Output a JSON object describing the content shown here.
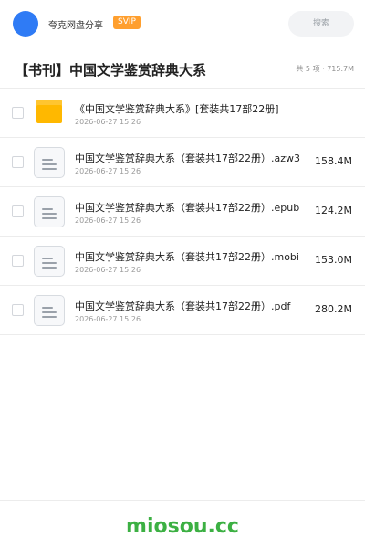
{
  "header": {
    "brand": "夸克网盘分享",
    "badge": "SVIP",
    "search_placeholder": "搜索",
    "accent_color": "#2f7bf5"
  },
  "share": {
    "title": "【书刊】中国文学鉴赏辞典大系",
    "meta": "共 5 项 · 715.7M"
  },
  "files": [
    {
      "icon": "folder-icon",
      "name": "《中国文学鉴赏辞典大系》[套装共17部22册]",
      "date": "2026-06-27 15:26",
      "size": ""
    },
    {
      "icon": "document-icon",
      "name": "中国文学鉴赏辞典大系（套装共17部22册）.azw3",
      "date": "2026-06-27 15:26",
      "size": "158.4M"
    },
    {
      "icon": "document-icon",
      "name": "中国文学鉴赏辞典大系（套装共17部22册）.epub",
      "date": "2026-06-27 15:26",
      "size": "124.2M"
    },
    {
      "icon": "document-icon",
      "name": "中国文学鉴赏辞典大系（套装共17部22册）.mobi",
      "date": "2026-06-27 15:26",
      "size": "153.0M"
    },
    {
      "icon": "document-icon",
      "name": "中国文学鉴赏辞典大系（套装共17部22册）.pdf",
      "date": "2026-06-27 15:26",
      "size": "280.2M"
    }
  ],
  "footer": {
    "watermark": "miosou.cc",
    "watermark_color": "#3cb043"
  }
}
